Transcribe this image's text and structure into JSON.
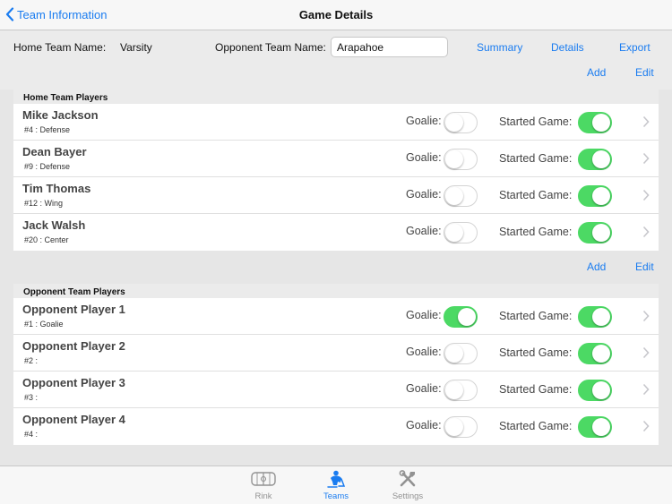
{
  "nav": {
    "back_label": "Team Information",
    "title": "Game Details"
  },
  "info": {
    "home_label": "Home Team Name:",
    "home_value": "Varsity",
    "opponent_label": "Opponent Team Name:",
    "opponent_value": "Arapahoe",
    "summary_link": "Summary",
    "details_link": "Details",
    "export_link": "Export"
  },
  "home_actions": {
    "add": "Add",
    "edit": "Edit"
  },
  "home_section": {
    "title": "Home Team Players",
    "players": [
      {
        "name": "Mike Jackson",
        "info": "#4 : Defense",
        "goalie": false,
        "started": true
      },
      {
        "name": "Dean Bayer",
        "info": "#9 : Defense",
        "goalie": false,
        "started": true
      },
      {
        "name": "Tim Thomas",
        "info": "#12 : Wing",
        "goalie": false,
        "started": true
      },
      {
        "name": "Jack Walsh",
        "info": "#20 : Center",
        "goalie": false,
        "started": true
      }
    ]
  },
  "opponent_actions": {
    "add": "Add",
    "edit": "Edit"
  },
  "opponent_section": {
    "title": "Opponent Team Players",
    "players": [
      {
        "name": "Opponent Player 1",
        "info": "#1 : Goalie",
        "goalie": true,
        "started": true
      },
      {
        "name": "Opponent Player 2",
        "info": "#2 :",
        "goalie": false,
        "started": true
      },
      {
        "name": "Opponent Player 3",
        "info": "#3 :",
        "goalie": false,
        "started": true
      },
      {
        "name": "Opponent Player 4",
        "info": "#4 :",
        "goalie": false,
        "started": true
      }
    ]
  },
  "row_labels": {
    "goalie": "Goalie:",
    "started": "Started Game:"
  },
  "tabs": [
    {
      "label": "Rink",
      "icon": "rink-icon",
      "active": false
    },
    {
      "label": "Teams",
      "icon": "hockey-player-icon",
      "active": true
    },
    {
      "label": "Settings",
      "icon": "tools-icon",
      "active": false
    }
  ],
  "colors": {
    "accent": "#1a7cf0",
    "toggle_on": "#4cd964",
    "background": "#e6e6e6"
  }
}
